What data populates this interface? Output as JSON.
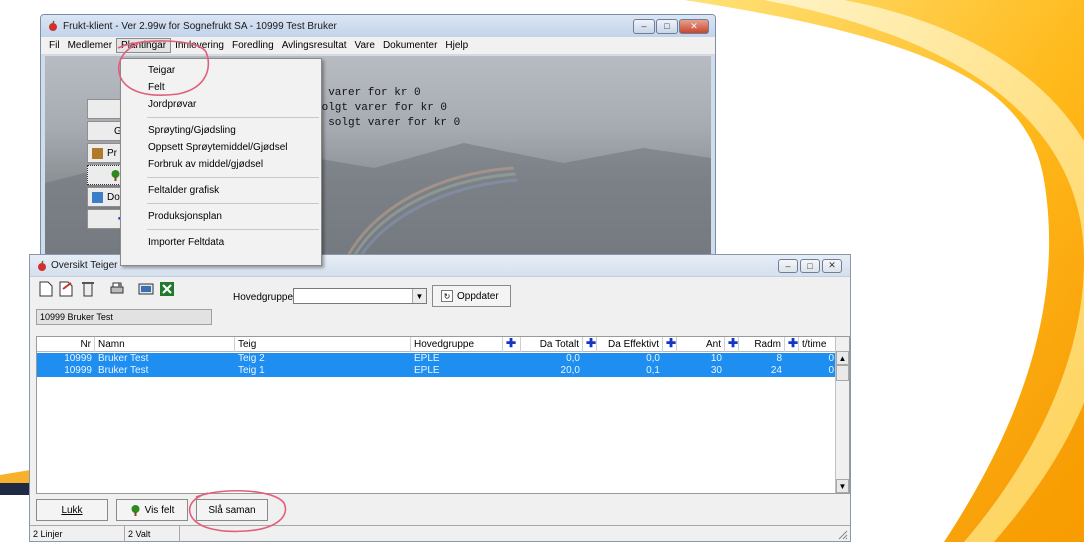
{
  "main_window": {
    "title": "Frukt-klient - Ver 2.99w for Sognefrukt SA - 10999 Test Bruker",
    "controls": {
      "minimize": "–",
      "maximize": "□",
      "close": "✕"
    },
    "menu": [
      "Fil",
      "Medlemer",
      "Plantingar",
      "Innlevering",
      "Foredling",
      "Avlingsresultat",
      "Vare",
      "Dokumenter",
      "Hjelp"
    ],
    "open_menu": "Plantingar",
    "console_lines": [
      "t varer for kr 0",
      "solgt varer for kr 0",
      "t solgt varer for kr 0"
    ],
    "side_buttons": [
      "S",
      "Gi",
      "Pr",
      "",
      "Do",
      ""
    ]
  },
  "dropdown": {
    "items": [
      "Teigar",
      "Felt",
      "Jordprøvar",
      "---",
      "Sprøyting/Gjødsling",
      "Oppsett Sprøytemiddel/Gjødsel",
      "Forbruk av middel/gjødsel",
      "---",
      "Feltalder grafisk",
      "---",
      "Produksjonsplan",
      "---",
      "Importer Feltdata"
    ]
  },
  "oversikt": {
    "title": "Oversikt Teiger",
    "hovedgruppe_label": "Hovedgruppe",
    "hovedgruppe_value": "",
    "oppdater_label": "Oppdater",
    "user_field": "10999 Bruker Test",
    "columns": [
      "Nr",
      "Namn",
      "Teig",
      "Hovedgruppe",
      "Da Totalt",
      "Da Effektivt",
      "Ant",
      "Radm",
      "t/time"
    ],
    "rows": [
      {
        "nr": "10999",
        "namn": "Bruker Test",
        "teig": "Teig 2",
        "hovedgruppe": "EPLE",
        "da_totalt": "0,0",
        "da_effektivt": "0,0",
        "ant": "10",
        "radm": "8",
        "ttime": "0"
      },
      {
        "nr": "10999",
        "namn": "Bruker Test",
        "teig": "Teig 1",
        "hovedgruppe": "EPLE",
        "da_totalt": "20,0",
        "da_effektivt": "0,1",
        "ant": "30",
        "radm": "24",
        "ttime": "0"
      }
    ],
    "buttons": {
      "lukk": "Lukk",
      "vis_felt": "Vis felt",
      "sla_saman": "Slå saman"
    },
    "status": {
      "linjer": "2 Linjer",
      "valt": "2 Valt"
    }
  },
  "colors": {
    "selection": "#1e8ef0",
    "plus": "#1437c4",
    "annotation": "#e0607a"
  }
}
